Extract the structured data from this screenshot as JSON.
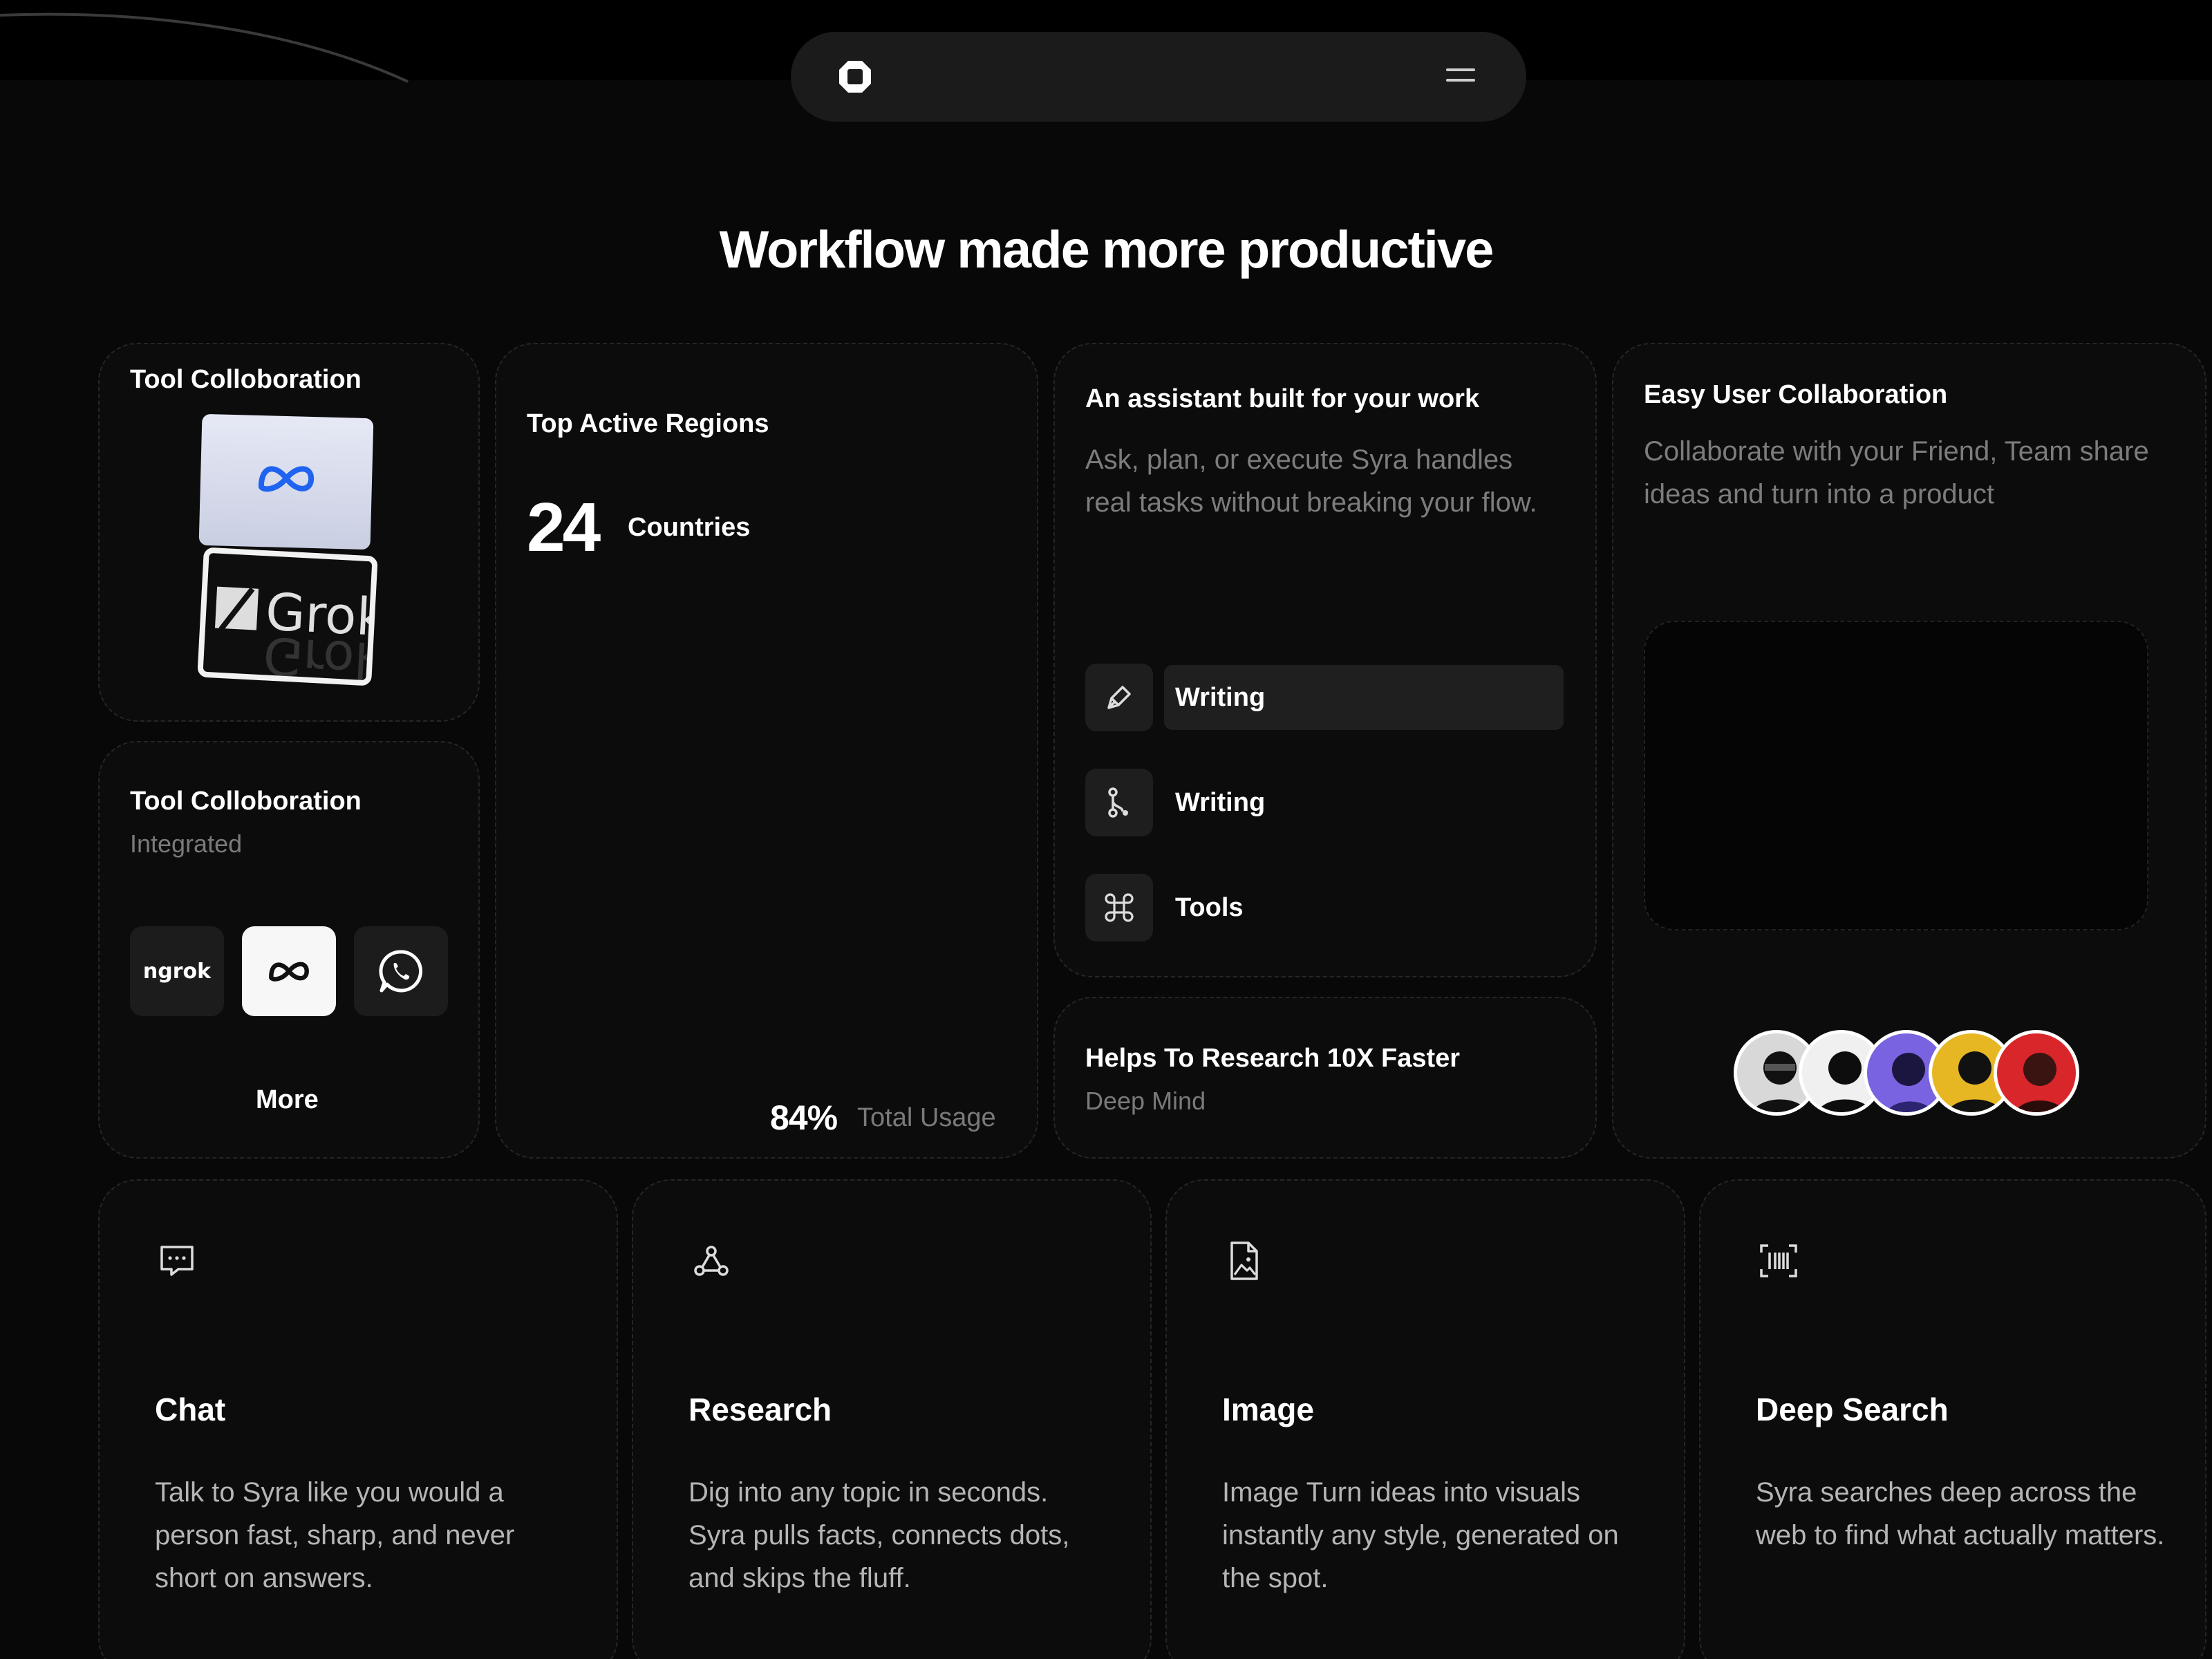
{
  "page": {
    "title": "Workflow made more productive"
  },
  "nav": {
    "logo_icon": "app-logo-icon",
    "menu_icon": "hamburger-menu-icon"
  },
  "tool_collab_logos": {
    "title": "Tool Colloboration",
    "logos": [
      "meta-logo-icon",
      "grok-logo-icon"
    ],
    "grok_text": "Grok"
  },
  "tool_collab_integrated": {
    "title": "Tool Colloboration",
    "subtitle": "Integrated",
    "tiles": [
      {
        "name": "ngrok",
        "label": "ngrok",
        "bg": "#1c1c1c"
      },
      {
        "name": "meta",
        "icon": "meta-logo-icon",
        "bg": "#f7f7f7"
      },
      {
        "name": "whatsapp",
        "icon": "whatsapp-icon",
        "bg": "#1c1c1c"
      }
    ],
    "more_label": "More"
  },
  "regions": {
    "title": "Top Active Regions",
    "count": "24",
    "count_label": "Countries",
    "usage_value": "84%",
    "usage_label": "Total Usage"
  },
  "assistant": {
    "title": "An assistant built for your work",
    "description": "Ask, plan, or execute Syra handles real tasks without breaking your flow.",
    "items": [
      {
        "icon": "pen-icon",
        "label": "Writing",
        "active": true
      },
      {
        "icon": "git-branch-icon",
        "label": "Writing",
        "active": false
      },
      {
        "icon": "command-key-icon",
        "label": "Tools",
        "active": false
      }
    ]
  },
  "research": {
    "title": "Helps To Research 10X Faster",
    "subtitle": "Deep Mind"
  },
  "collaboration": {
    "title": "Easy User Collaboration",
    "description": "Collaborate with your Friend, Team share ideas and turn into a product",
    "avatars": [
      "#d8d8d8",
      "#f0f0f0",
      "#7a63e0",
      "#e7b623",
      "#d9262b"
    ]
  },
  "features": [
    {
      "icon": "chat-icon",
      "title": "Chat",
      "description": "Talk to Syra like you would a person fast, sharp, and never short on answers."
    },
    {
      "icon": "webhook-icon",
      "title": "Research",
      "description": "Dig into any topic in seconds. Syra pulls facts, connects dots, and skips the fluff."
    },
    {
      "icon": "image-file-icon",
      "title": "Image",
      "description": "Image  Turn ideas into visuals instantly any style, generated on the spot."
    },
    {
      "icon": "barcode-scan-icon",
      "title": "Deep Search",
      "description": " Syra searches deep across the web to find what actually matters."
    }
  ],
  "colors": {
    "background": "#080808",
    "card": "#0c0c0c",
    "muted_text": "#7a7a7a",
    "body_text": "#b5b5b5"
  }
}
